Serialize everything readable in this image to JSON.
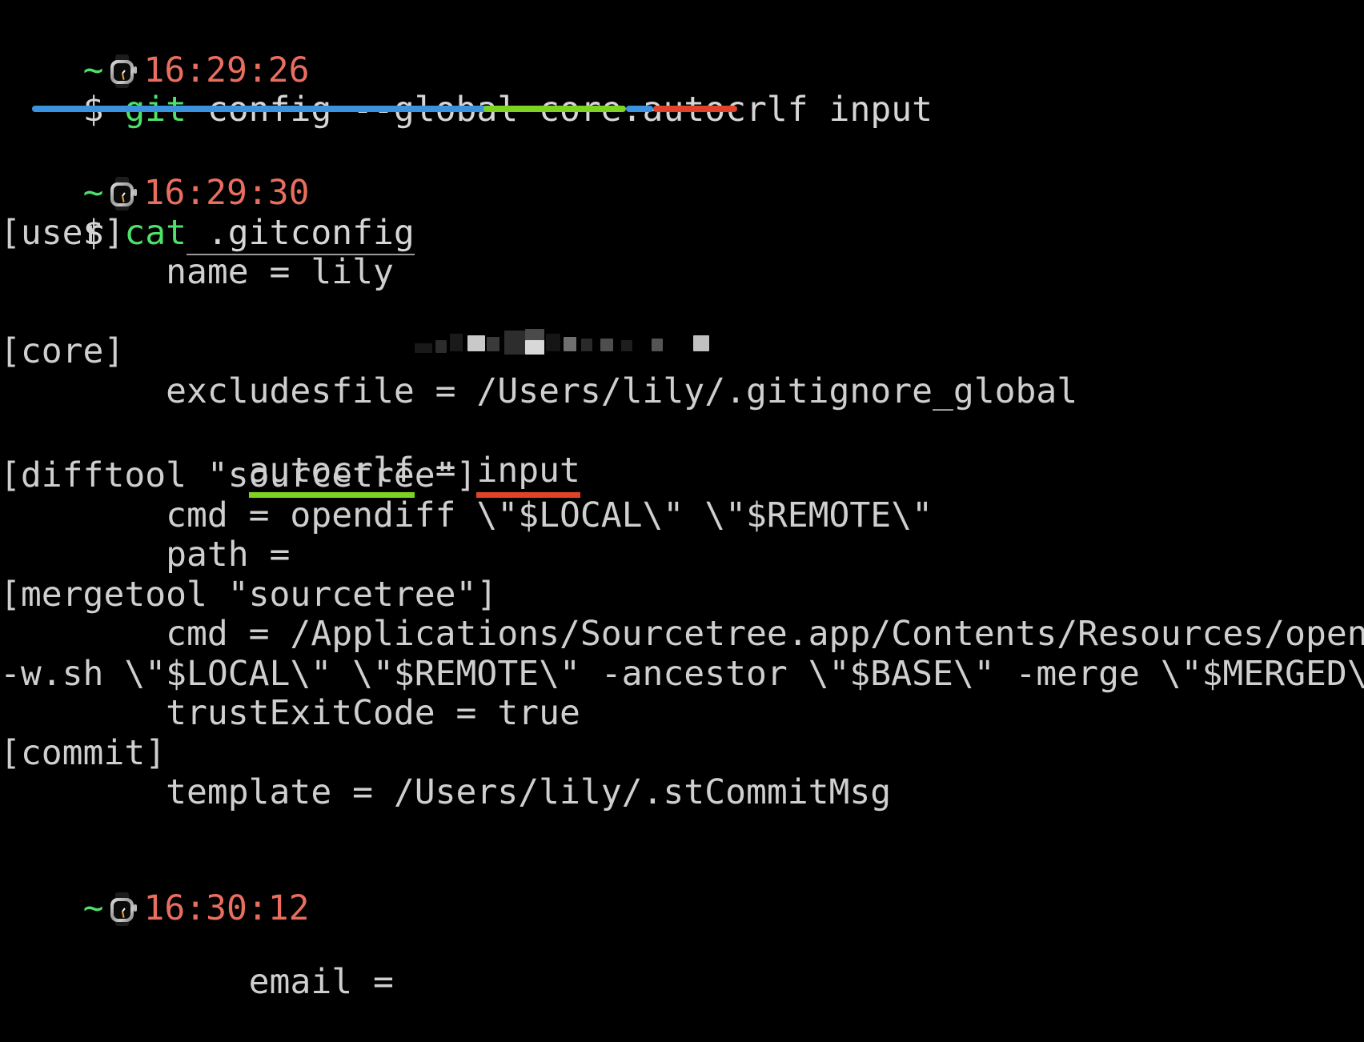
{
  "terminal": {
    "background_color": "#000000",
    "default_text_color": "#cfcfcf",
    "prompt_symbol": "~",
    "prompt_symbol_color": "#4ee16a",
    "time_color": "#ea6e5f",
    "command_color": "#4ee16a",
    "dollar": "$",
    "watch_icon_name": "watch-icon"
  },
  "annotations": {
    "blue_color": "#3b93e0",
    "green_color": "#7ed320",
    "red_color": "#e0432a"
  },
  "blocks": [
    {
      "timestamp": "16:29:26",
      "command_name": "git",
      "command_args": " config --global core.autocrlf input"
    },
    {
      "timestamp": "16:29:30",
      "command_name": "cat",
      "command_args": " .gitconfig"
    },
    {
      "timestamp": "16:30:12",
      "command_name": "",
      "command_args": ""
    }
  ],
  "output": {
    "lines": [
      "[user]",
      "        name = lily",
      "        email = ",
      "[core]",
      "        excludesfile = /Users/lily/.gitignore_global",
      "        autocrlf = input",
      "[difftool \"sourcetree\"]",
      "        cmd = opendiff \\\"$LOCAL\\\" \\\"$REMOTE\\\"",
      "        path = ",
      "[mergetool \"sourcetree\"]",
      "        cmd = /Applications/Sourcetree.app/Contents/Resources/opendiff",
      "-w.sh \\\"$LOCAL\\\" \\\"$REMOTE\\\" -ancestor \\\"$BASE\\\" -merge \\\"$MERGED\\\"",
      "        trustExitCode = true",
      "[commit]",
      "        template = /Users/lily/.stCommitMsg"
    ],
    "user_section": "[user]",
    "name_line": "        name = lily",
    "email_label": "        email = ",
    "email_value_redacted": true,
    "core_section": "[core]",
    "excludesfile_line": "        excludesfile = /Users/lily/.gitignore_global",
    "autocrlf_indent": "        ",
    "autocrlf_key": "autocrlf",
    "autocrlf_eq": " = ",
    "autocrlf_value": "input",
    "difftool_section": "[difftool \"sourcetree\"]",
    "difftool_cmd": "        cmd = opendiff \\\"$LOCAL\\\" \\\"$REMOTE\\\"",
    "difftool_path": "        path = ",
    "mergetool_section": "[mergetool \"sourcetree\"]",
    "mergetool_cmd_1": "        cmd = /Applications/Sourcetree.app/Contents/Resources/opendiff",
    "mergetool_cmd_2": "-w.sh \\\"$LOCAL\\\" \\\"$REMOTE\\\" -ancestor \\\"$BASE\\\" -merge \\\"$MERGED\\\"",
    "mergetool_trust": "        trustExitCode = true",
    "commit_section": "[commit]",
    "commit_template": "        template = /Users/lily/.stCommitMsg"
  }
}
